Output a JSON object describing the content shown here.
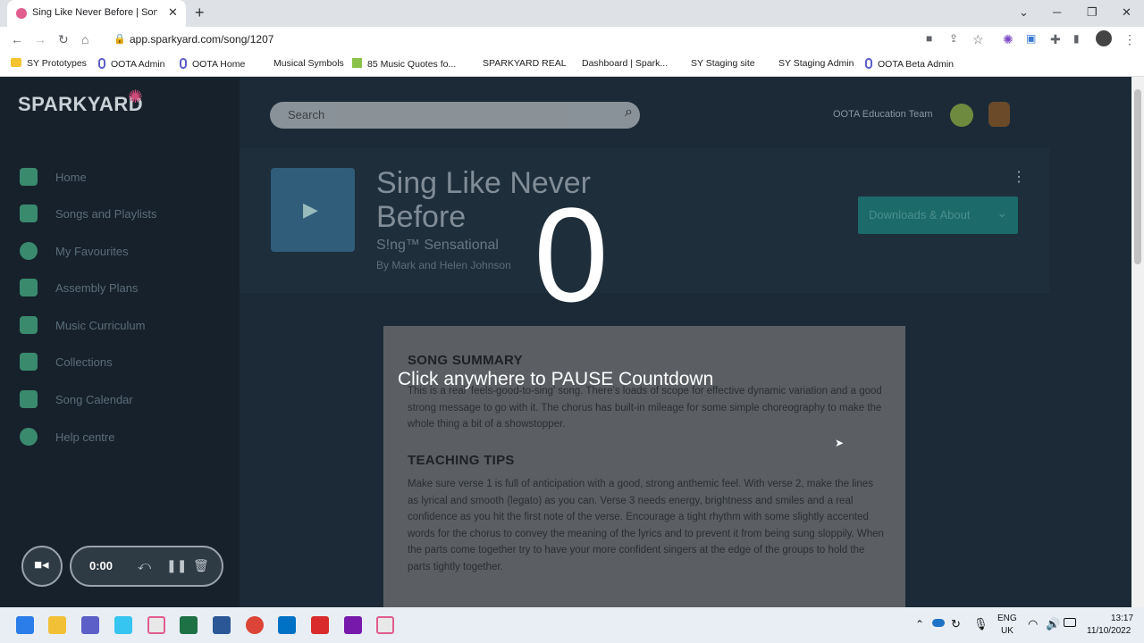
{
  "browser": {
    "tab_title": "Sing Like Never Before | Song | Sp",
    "tab_close": "✕",
    "new_tab": "+",
    "url": "app.sparkyard.com/song/1207",
    "win_min": "─",
    "win_max": "❐",
    "win_close": "✕",
    "win_dropdown": "⌄"
  },
  "bookmarks": [
    {
      "label": "SY Prototypes",
      "icon": "folder-icon"
    },
    {
      "label": "OOTA Admin",
      "icon": "oota-icon"
    },
    {
      "label": "OOTA Home",
      "icon": "oota-icon"
    },
    {
      "label": "Musical Symbols",
      "icon": "none"
    },
    {
      "label": "85 Music Quotes fo...",
      "icon": "green-icon"
    },
    {
      "label": "SPARKYARD REAL",
      "icon": "none"
    },
    {
      "label": "Dashboard | Spark...",
      "icon": "none"
    },
    {
      "label": "SY Staging site",
      "icon": "none"
    },
    {
      "label": "SY Staging Admin",
      "icon": "none"
    },
    {
      "label": "OOTA Beta Admin",
      "icon": "oota-icon"
    }
  ],
  "app": {
    "logo": "SPARKYARD",
    "search_placeholder": "Search",
    "team_name": "OOTA Education Team",
    "nav": [
      {
        "label": "Home",
        "icon": "home-icon"
      },
      {
        "label": "Songs and Playlists",
        "icon": "music-note-icon"
      },
      {
        "label": "My Favourites",
        "icon": "heart-icon"
      },
      {
        "label": "Assembly Plans",
        "icon": "people-icon"
      },
      {
        "label": "Music Curriculum",
        "icon": "book-icon"
      },
      {
        "label": "Collections",
        "icon": "collections-icon"
      },
      {
        "label": "Song Calendar",
        "icon": "calendar-icon"
      },
      {
        "label": "Help centre",
        "icon": "help-icon"
      }
    ],
    "song": {
      "title": "Sing Like Never Before",
      "subtitle": "S!ng™ Sensational",
      "by": "By Mark and Helen Johnson",
      "downloads_button": "Downloads & About"
    },
    "summary_heading": "SONG SUMMARY",
    "summary_text": "This is a real ‘feels-good-to-sing’ song. There’s loads of scope for effective dynamic variation and a good strong message to go with it. The chorus has built-in mileage for some simple choreography to make the whole thing a bit of a showstopper.",
    "tips_heading": "TEACHING TIPS",
    "tips_text": "Make sure verse 1 is full of anticipation with a good, strong anthemic feel. With verse 2, make the lines as lyrical and smooth (legato) as you can. Verse 3 needs energy, brightness and smiles and a real confidence as you hit the first note of the verse. Encourage a tight rhythm with some slightly accented words for the chorus to convey the meaning of the lyrics and to prevent it from being sung sloppily. When the parts come together try to have your more confident singers at the edge of the groups to hold the parts tightly together."
  },
  "overlay": {
    "countdown": "0",
    "message": "Click anywhere to PAUSE Countdown"
  },
  "recorder": {
    "time": "0:00"
  },
  "taskbar": {
    "lang_line1": "ENG",
    "lang_line2": "UK",
    "time": "13:17",
    "date": "11/10/2022"
  }
}
